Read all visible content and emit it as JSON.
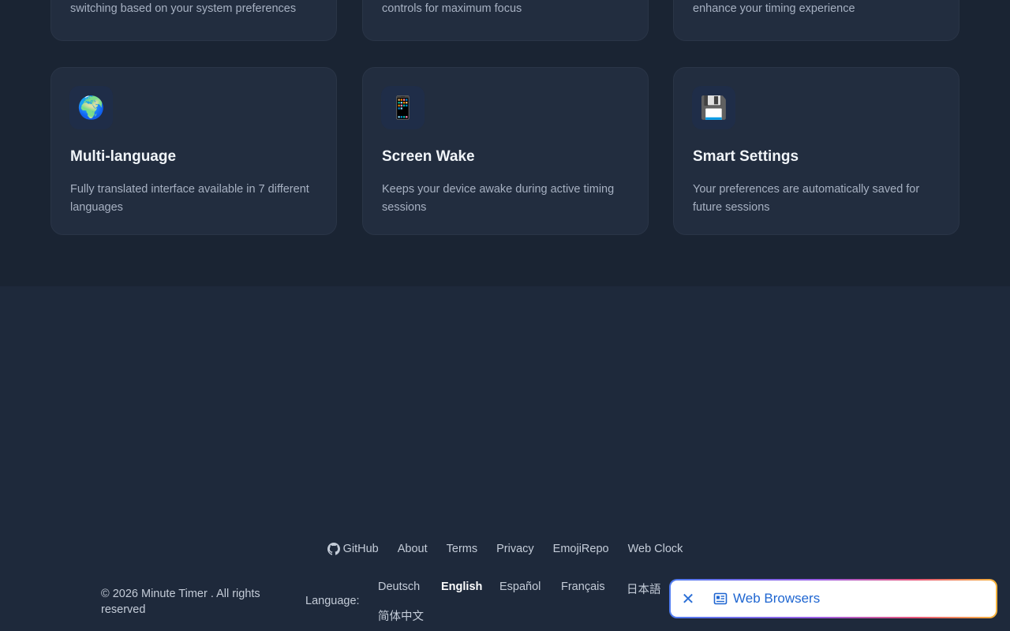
{
  "features": {
    "top_row": [
      {
        "desc": "switching based on your system preferences"
      },
      {
        "desc": "controls for maximum focus"
      },
      {
        "desc": "enhance your timing experience"
      }
    ],
    "bottom_row": [
      {
        "icon": "🌍",
        "icon_name": "globe-icon",
        "title": "Multi-language",
        "desc": "Fully translated interface available in 7 different languages"
      },
      {
        "icon": "📱",
        "icon_name": "mobile-phone-icon",
        "title": "Screen Wake",
        "desc": "Keeps your device awake during active timing sessions"
      },
      {
        "icon": "💾",
        "icon_name": "floppy-disk-icon",
        "title": "Smart Settings",
        "desc": "Your preferences are automatically saved for future sessions"
      }
    ]
  },
  "footer": {
    "links": {
      "github": "GitHub",
      "about": "About",
      "terms": "Terms",
      "privacy": "Privacy",
      "emojirepo": "EmojiRepo",
      "webclock": "Web Clock"
    },
    "copyright": "© 2026 Minute Timer . All rights reserved",
    "language_label": "Language:",
    "languages": [
      "Deutsch",
      "English",
      "Español",
      "Français",
      "日本語",
      "简体中文"
    ],
    "active_language": "English"
  },
  "popup": {
    "label": "Web Browsers",
    "close_glyph": "✕"
  },
  "colors": {
    "background": "#1e293b",
    "card": "#222d3f",
    "popup_text": "#1f66d1"
  }
}
